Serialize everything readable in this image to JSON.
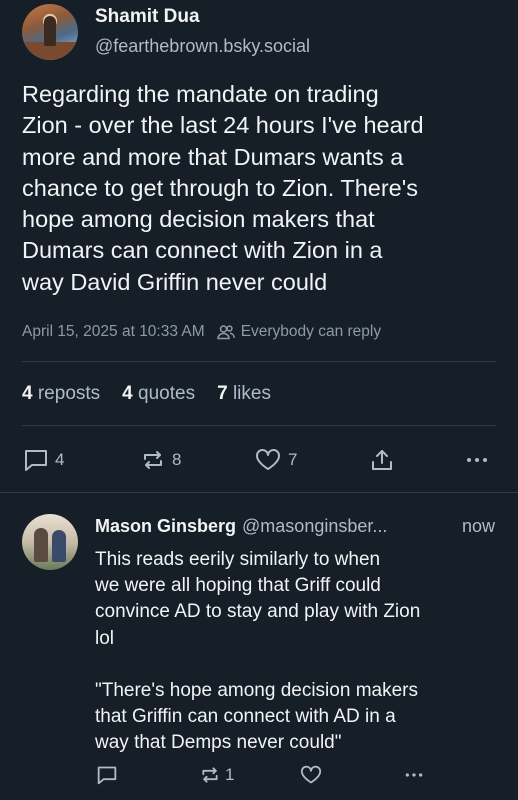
{
  "post": {
    "author_name": "Shamit Dua",
    "author_handle": "@fearthebrown.bsky.social",
    "text_lines": [
      "Regarding the mandate on trading",
      "Zion - over the last 24 hours I've heard",
      "more and more that Dumars wants a",
      "chance to get through to Zion. There's",
      "hope among decision makers that",
      "Dumars can connect with Zion in a",
      "way David Griffin never could"
    ],
    "timestamp": "April 15, 2025 at 10:33 AM",
    "reply_setting": "Everybody can reply",
    "stats": {
      "reposts_count": "4",
      "reposts_label": "reposts",
      "quotes_count": "4",
      "quotes_label": "quotes",
      "likes_count": "7",
      "likes_label": "likes"
    },
    "actions": {
      "reply_count": "4",
      "repost_count": "8",
      "like_count": "7"
    }
  },
  "reply": {
    "author_name": "Mason Ginsberg",
    "author_handle": "@masonginsber...",
    "time": "now",
    "text_lines": [
      "This reads eerily similarly to when",
      "we were all hoping that Griff could",
      "convince AD to stay and play with Zion",
      "lol",
      "",
      "\"There's hope among decision makers",
      "that Griffin can connect with AD in a",
      "way that Demps never could\""
    ],
    "actions": {
      "repost_count": "1"
    }
  },
  "colors": {
    "background": "#161e27",
    "text_primary": "#f1f3f5",
    "text_secondary": "#aebbc9",
    "text_muted": "#8c9bab",
    "divider": "#2e3a47"
  },
  "icons": {
    "reply": "speech-bubble-icon",
    "repost": "repost-arrows-icon",
    "like": "heart-icon",
    "share": "share-upload-icon",
    "more": "ellipsis-icon",
    "reply_setting": "people-icon"
  }
}
